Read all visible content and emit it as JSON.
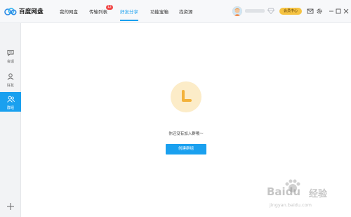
{
  "app": {
    "name": "百度网盘"
  },
  "nav": {
    "items": [
      {
        "label": "我的网盘"
      },
      {
        "label": "传输列表",
        "badge": "12"
      },
      {
        "label": "好友分享"
      },
      {
        "label": "功能宝箱"
      },
      {
        "label": "找资源"
      }
    ],
    "active_index": 2
  },
  "account": {
    "vip_label": "会员中心"
  },
  "sidebar": {
    "items": [
      {
        "label": "会话"
      },
      {
        "label": "好友"
      },
      {
        "label": "群组"
      }
    ],
    "active_index": 2
  },
  "main": {
    "empty_text": "你还没有加入群哦～",
    "create_button": "创建群组"
  },
  "watermark": {
    "brand": "Baidu",
    "sub": "经验",
    "url": "jingyan.baidu.com"
  },
  "colors": {
    "accent": "#1aa0ef",
    "badge": "#f04848",
    "vip": "#f5c342",
    "empty_circle": "#fcecc8",
    "clock": "#f3b23a"
  }
}
